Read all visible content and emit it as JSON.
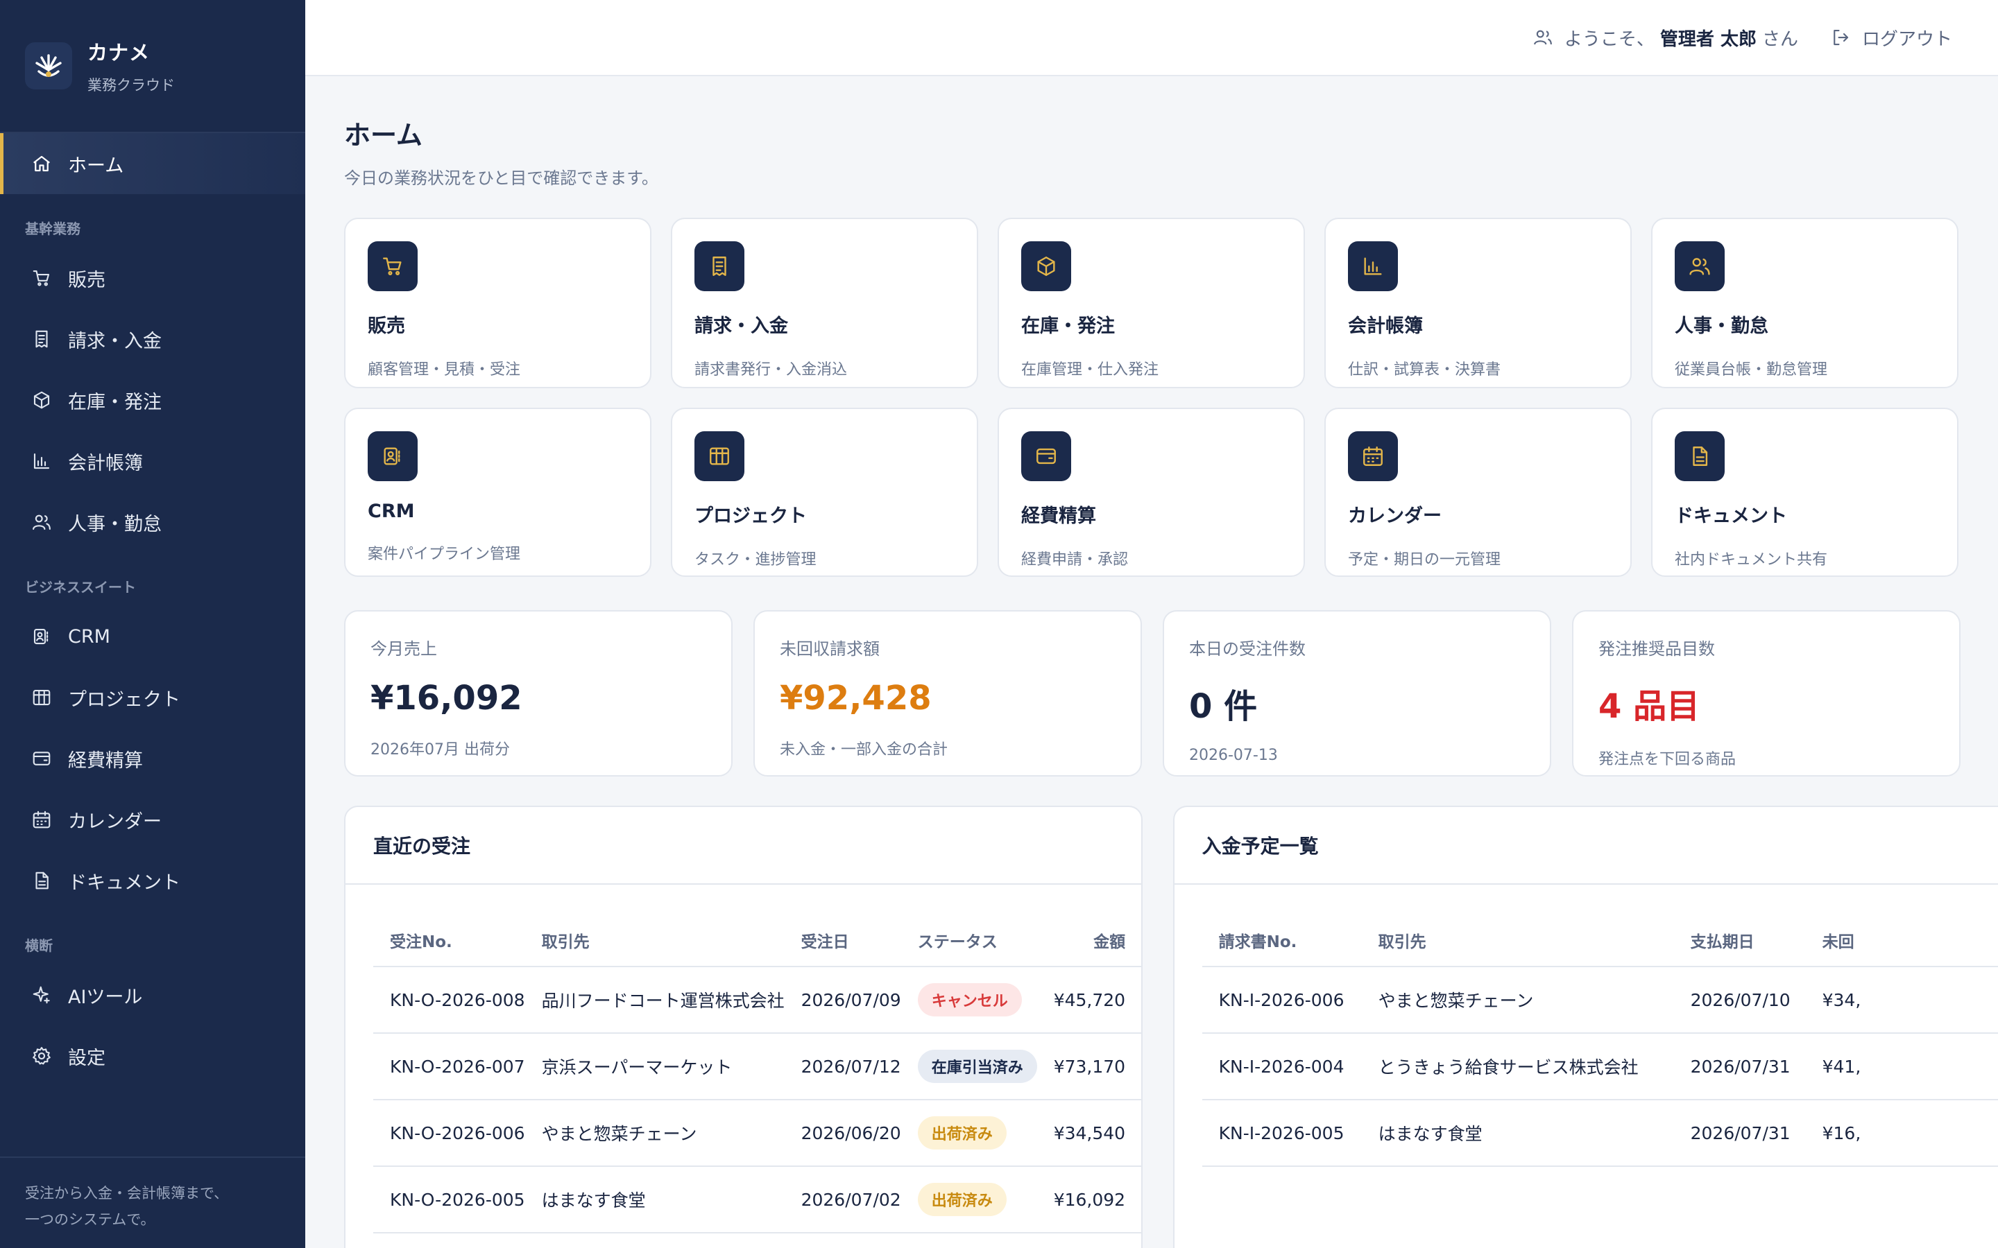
{
  "brand": {
    "name": "カナメ",
    "sub": "業務クラウド"
  },
  "sidebar": {
    "home": "ホーム",
    "section_core": "基幹業務",
    "core": [
      {
        "label": "販売",
        "icon": "cart-icon"
      },
      {
        "label": "請求・入金",
        "icon": "receipt-icon"
      },
      {
        "label": "在庫・発注",
        "icon": "box-icon"
      },
      {
        "label": "会計帳簿",
        "icon": "chart-icon"
      },
      {
        "label": "人事・勤怠",
        "icon": "users-icon"
      }
    ],
    "section_suite": "ビジネススイート",
    "suite": [
      {
        "label": "CRM",
        "icon": "contact-icon"
      },
      {
        "label": "プロジェクト",
        "icon": "kanban-icon"
      },
      {
        "label": "経費精算",
        "icon": "wallet-icon"
      },
      {
        "label": "カレンダー",
        "icon": "calendar-icon"
      },
      {
        "label": "ドキュメント",
        "icon": "document-icon"
      }
    ],
    "section_cross": "横断",
    "cross": [
      {
        "label": "AIツール",
        "icon": "sparkle-icon"
      },
      {
        "label": "設定",
        "icon": "gear-icon"
      }
    ],
    "footer_line1": "受注から入金・会計帳簿まで、",
    "footer_line2": "一つのシステムで。"
  },
  "topbar": {
    "welcome_prefix": "ようこそ、",
    "user_name": "管理者 太郎",
    "welcome_suffix": "さん",
    "logout": "ログアウト"
  },
  "page": {
    "title": "ホーム",
    "subtitle": "今日の業務状況をひと目で確認できます。"
  },
  "modules": [
    {
      "title": "販売",
      "desc": "顧客管理・見積・受注",
      "icon": "cart-icon"
    },
    {
      "title": "請求・入金",
      "desc": "請求書発行・入金消込",
      "icon": "receipt-icon"
    },
    {
      "title": "在庫・発注",
      "desc": "在庫管理・仕入発注",
      "icon": "box-icon"
    },
    {
      "title": "会計帳簿",
      "desc": "仕訳・試算表・決算書",
      "icon": "chart-icon"
    },
    {
      "title": "人事・勤怠",
      "desc": "従業員台帳・勤怠管理",
      "icon": "users-icon"
    },
    {
      "title": "CRM",
      "desc": "案件パイプライン管理",
      "icon": "contact-icon"
    },
    {
      "title": "プロジェクト",
      "desc": "タスク・進捗管理",
      "icon": "kanban-icon"
    },
    {
      "title": "経費精算",
      "desc": "経費申請・承認",
      "icon": "wallet-icon"
    },
    {
      "title": "カレンダー",
      "desc": "予定・期日の一元管理",
      "icon": "calendar-icon"
    },
    {
      "title": "ドキュメント",
      "desc": "社内ドキュメント共有",
      "icon": "document-icon"
    }
  ],
  "stats": [
    {
      "label": "今月売上",
      "value": "¥16,092",
      "note": "2026年07月 出荷分",
      "color": "#1a2540"
    },
    {
      "label": "未回収請求額",
      "value": "¥92,428",
      "note": "未入金・一部入金の合計",
      "color": "#dd7d10"
    },
    {
      "label": "本日の受注件数",
      "value": "0 件",
      "note": "2026-07-13",
      "color": "#1a2540"
    },
    {
      "label": "発注推奨品目数",
      "value": "4 品目",
      "note": "発注点を下回る商品",
      "color": "#d8262a"
    }
  ],
  "orders": {
    "title": "直近の受注",
    "headers": [
      "受注No.",
      "取引先",
      "受注日",
      "ステータス",
      "金額"
    ],
    "rows": [
      {
        "no": "KN-O-2026-008",
        "client": "品川フードコート運営株式会社",
        "date": "2026/07/09",
        "status": "キャンセル",
        "status_kind": "cancel",
        "amount": "¥45,720"
      },
      {
        "no": "KN-O-2026-007",
        "client": "京浜スーパーマーケット",
        "date": "2026/07/12",
        "status": "在庫引当済み",
        "status_kind": "alloc",
        "amount": "¥73,170"
      },
      {
        "no": "KN-O-2026-006",
        "client": "やまと惣菜チェーン",
        "date": "2026/06/20",
        "status": "出荷済み",
        "status_kind": "ship",
        "amount": "¥34,540"
      },
      {
        "no": "KN-O-2026-005",
        "client": "はまなす食堂",
        "date": "2026/07/02",
        "status": "出荷済み",
        "status_kind": "ship",
        "amount": "¥16,092"
      }
    ]
  },
  "payments": {
    "title": "入金予定一覧",
    "headers": [
      "請求書No.",
      "取引先",
      "支払期日",
      "未回"
    ],
    "rows": [
      {
        "no": "KN-I-2026-006",
        "client": "やまと惣菜チェーン",
        "due": "2026/07/10",
        "amount": "¥34,"
      },
      {
        "no": "KN-I-2026-004",
        "client": "とうきょう給食サービス株式会社",
        "due": "2026/07/31",
        "amount": "¥41,"
      },
      {
        "no": "KN-I-2026-005",
        "client": "はまなす食堂",
        "due": "2026/07/31",
        "amount": "¥16,"
      }
    ]
  }
}
